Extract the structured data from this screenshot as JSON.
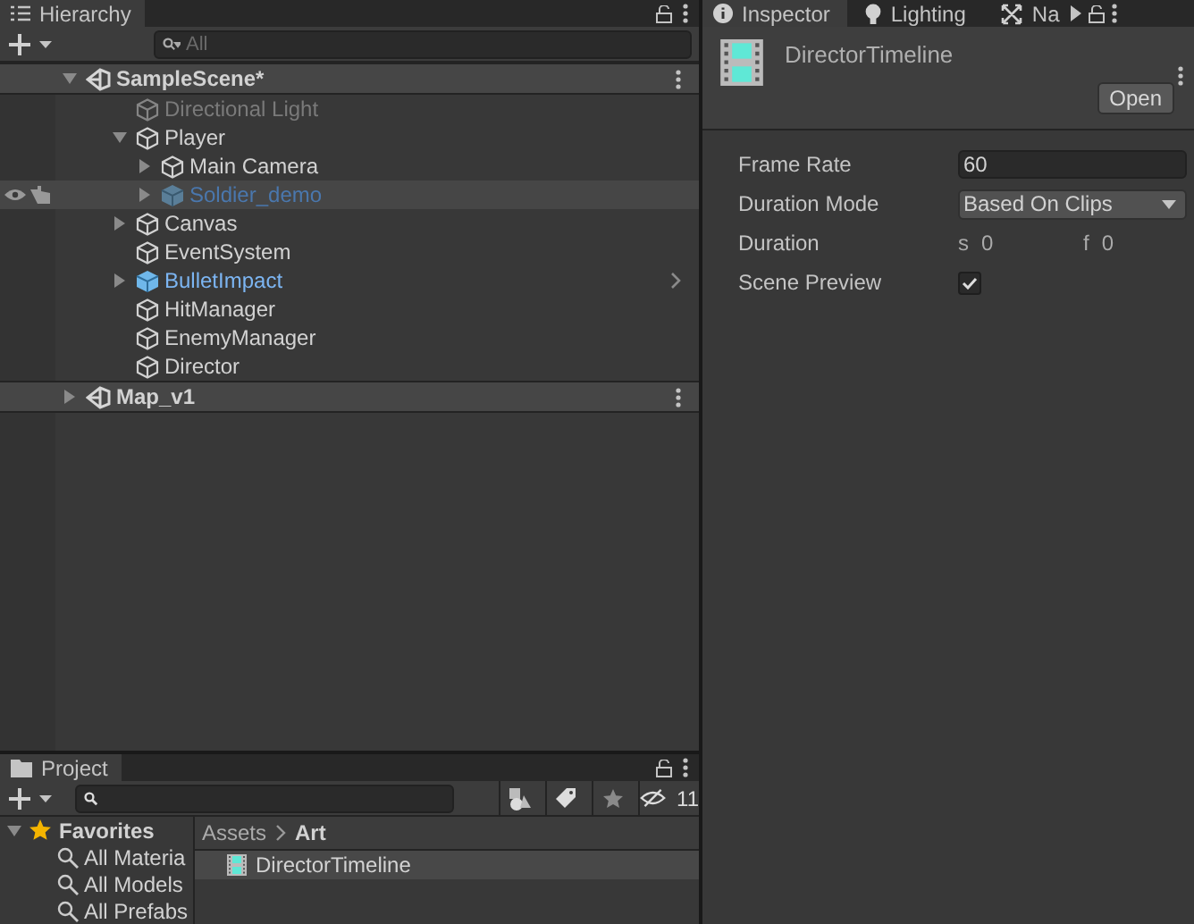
{
  "hierarchy": {
    "tab": {
      "label": "Hierarchy",
      "selected": true
    },
    "search": {
      "placeholder": "All"
    },
    "tree": [
      {
        "kind": "scene",
        "label": "SampleScene*",
        "expanded": true,
        "hovered": false,
        "children": [
          {
            "kind": "object",
            "label": "Directional Light",
            "disabled": true,
            "hovered": false
          },
          {
            "kind": "object",
            "label": "Player",
            "expanded": true,
            "disabled": false,
            "hovered": false,
            "children": [
              {
                "kind": "object",
                "label": "Main Camera",
                "expanded": false,
                "disabled": false,
                "hovered": false
              },
              {
                "kind": "prefab",
                "label": "Soldier_demo",
                "expanded": false,
                "disabled": true,
                "hovered": true
              }
            ]
          },
          {
            "kind": "object",
            "label": "Canvas",
            "expanded": false,
            "disabled": false,
            "hovered": false
          },
          {
            "kind": "object",
            "label": "EventSystem",
            "disabled": false,
            "hovered": false
          },
          {
            "kind": "prefab",
            "label": "BulletImpact",
            "expanded": false,
            "disabled": false,
            "hovered": false,
            "open_arrow": true
          },
          {
            "kind": "object",
            "label": "HitManager",
            "disabled": false,
            "hovered": false
          },
          {
            "kind": "object",
            "label": "EnemyManager",
            "disabled": false,
            "hovered": false
          },
          {
            "kind": "object",
            "label": "Director",
            "disabled": false,
            "hovered": false
          }
        ]
      },
      {
        "kind": "scene",
        "label": "Map_v1",
        "expanded": false,
        "hovered": false
      }
    ]
  },
  "inspector": {
    "tabs": [
      {
        "label": "Inspector",
        "kind": "info",
        "selected": true
      },
      {
        "label": "Lighting",
        "kind": "bulb",
        "selected": false
      },
      {
        "label": "Na",
        "kind": "nav",
        "selected": false
      }
    ],
    "title": "DirectorTimeline",
    "open_button": "Open",
    "fields": [
      {
        "kind": "input",
        "label": "Frame Rate",
        "value": "60"
      },
      {
        "kind": "dropdown",
        "label": "Duration Mode",
        "value": "Based On Clips"
      },
      {
        "kind": "duration",
        "label": "Duration",
        "s_label": "s",
        "s_value": "0",
        "f_label": "f",
        "f_value": "0"
      },
      {
        "kind": "checkbox",
        "label": "Scene Preview",
        "checked": true
      }
    ]
  },
  "project": {
    "tab": {
      "label": "Project",
      "selected": true
    },
    "hidden_count": "11",
    "favorites": {
      "label": "Favorites",
      "expanded": true,
      "items": [
        "All Materia",
        "All Models",
        "All Prefabs"
      ]
    },
    "breadcrumb": [
      "Assets",
      "Art"
    ],
    "assets": [
      {
        "label": "DirectorTimeline",
        "selected": true
      }
    ]
  }
}
